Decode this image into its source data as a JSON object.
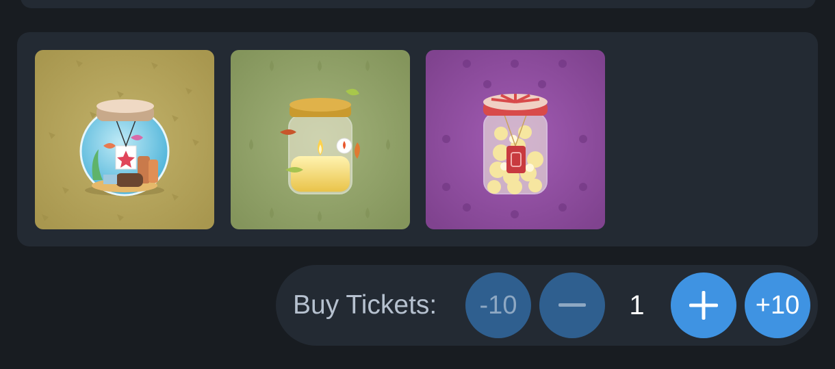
{
  "items": [
    {
      "name": "fish-bowl-jar",
      "bg": "#b3a25a"
    },
    {
      "name": "candle-jar",
      "bg": "#93a46c"
    },
    {
      "name": "popcorn-jar",
      "bg": "#8d4e9e"
    }
  ],
  "buy": {
    "label": "Buy Tickets:",
    "minus10_label": "-10",
    "minus_icon": "minus-icon",
    "quantity": "1",
    "plus_icon": "plus-icon",
    "plus10_label": "+10"
  },
  "colors": {
    "background": "#181c21",
    "panel": "#232a33",
    "button_disabled": "#2f5f8f",
    "button_active": "#3f93e2"
  }
}
